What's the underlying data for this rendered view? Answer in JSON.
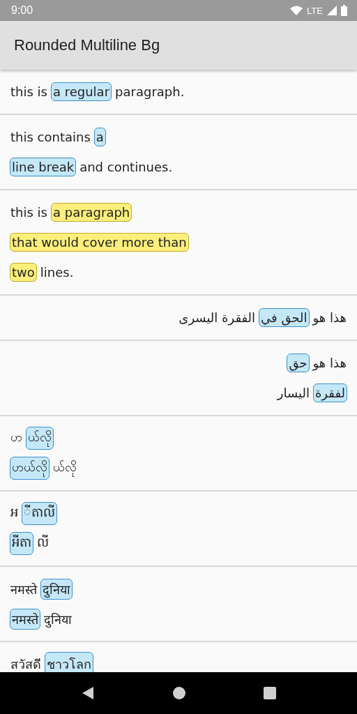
{
  "status_bar": {
    "time": "9:00",
    "network": "LTE"
  },
  "app_bar": {
    "title": "Rounded Multiline Bg"
  },
  "paragraphs": [
    {
      "rtl": false,
      "color": "#c5e8f8",
      "lines": [
        [
          {
            "text": "this is",
            "marked": false
          },
          {
            "text": "a regular",
            "marked": true
          },
          {
            "text": "paragraph.",
            "marked": false
          }
        ]
      ]
    },
    {
      "rtl": false,
      "color": "#c5e8f8",
      "lines": [
        [
          {
            "text": "this contains",
            "marked": false
          },
          {
            "text": "a",
            "marked": true
          }
        ],
        [
          {
            "text": "line break",
            "marked": true
          },
          {
            "text": "and continues.",
            "marked": false
          }
        ]
      ]
    },
    {
      "rtl": false,
      "color": "#fcef7c",
      "lines": [
        [
          {
            "text": "this is",
            "marked": false
          },
          {
            "text": "a paragraph ",
            "marked": true
          }
        ],
        [
          {
            "text": "that would cover more than",
            "marked": true
          }
        ],
        [
          {
            "text": "two",
            "marked": true
          },
          {
            "text": "lines.",
            "marked": false
          }
        ]
      ]
    },
    {
      "rtl": true,
      "color": "#c5e8f8",
      "lines": [
        [
          {
            "text": "هذا هو",
            "marked": false
          },
          {
            "text": "الحق في",
            "marked": true
          },
          {
            "text": "الفقرة اليسرى",
            "marked": false
          }
        ]
      ]
    },
    {
      "rtl": true,
      "color": "#c5e8f8",
      "lines": [
        [
          {
            "text": "هذا هو",
            "marked": false
          },
          {
            "text": "حق",
            "marked": true
          }
        ],
        [
          {
            "text": "لفقرة",
            "marked": true
          },
          {
            "text": "اليسار",
            "marked": false
          }
        ]
      ]
    },
    {
      "rtl": false,
      "color": "#c5e8f8",
      "lines": [
        [
          {
            "text": "ဟ",
            "marked": false
          },
          {
            "text": "ယ်လို",
            "marked": true
          }
        ],
        [
          {
            "text": "ဟယ်လို",
            "marked": true
          },
          {
            "text": "ယ်လို",
            "marked": false
          }
        ]
      ]
    },
    {
      "rtl": false,
      "color": "#c5e8f8",
      "lines": [
        [
          {
            "text": "អ",
            "marked": false
          },
          {
            "text": "ីតាលី",
            "marked": true
          }
        ],
        [
          {
            "text": "អីតា",
            "marked": true
          },
          {
            "text": "លី",
            "marked": false
          }
        ]
      ]
    },
    {
      "rtl": false,
      "color": "#c5e8f8",
      "lines": [
        [
          {
            "text": "नमस्ते",
            "marked": false
          },
          {
            "text": "दुनिया",
            "marked": true
          }
        ],
        [
          {
            "text": "नमस्ते",
            "marked": true
          },
          {
            "text": "दुनिया",
            "marked": false
          }
        ]
      ]
    },
    {
      "rtl": false,
      "color": "#c5e8f8",
      "lines": [
        [
          {
            "text": "สวัสดี",
            "marked": false
          },
          {
            "text": "ชาวโลก",
            "marked": true
          }
        ]
      ]
    }
  ]
}
